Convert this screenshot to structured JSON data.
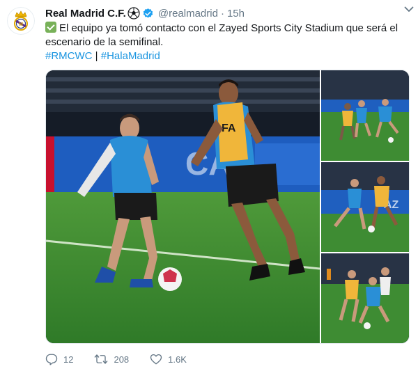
{
  "account": {
    "name": "Real Madrid C.F.",
    "handle": "@realmadrid",
    "separator": "·",
    "time": "15h",
    "avatar_icon": "real-madrid-crest"
  },
  "tweet": {
    "text": "El equipo ya tomó contacto con el Zayed Sports City Stadium que será el escenario de la semifinal.",
    "hashtags": [
      "#RMCWC",
      "#HalaMadrid"
    ],
    "hashtag_separator": "|",
    "photos": [
      {
        "id": "main",
        "subject": "two players training with a ball on the pitch"
      },
      {
        "id": "top-right",
        "subject": "players in a training drill"
      },
      {
        "id": "middle-right",
        "subject": "players contesting the ball"
      },
      {
        "id": "bottom-right",
        "subject": "players running with the ball"
      }
    ]
  },
  "stats": {
    "replies": "12",
    "retweets": "208",
    "likes": "1.6K"
  },
  "colors": {
    "link": "#1b95e0",
    "verified": "#1da1f2",
    "check_emoji": "#78b159",
    "muted": "#657786"
  }
}
